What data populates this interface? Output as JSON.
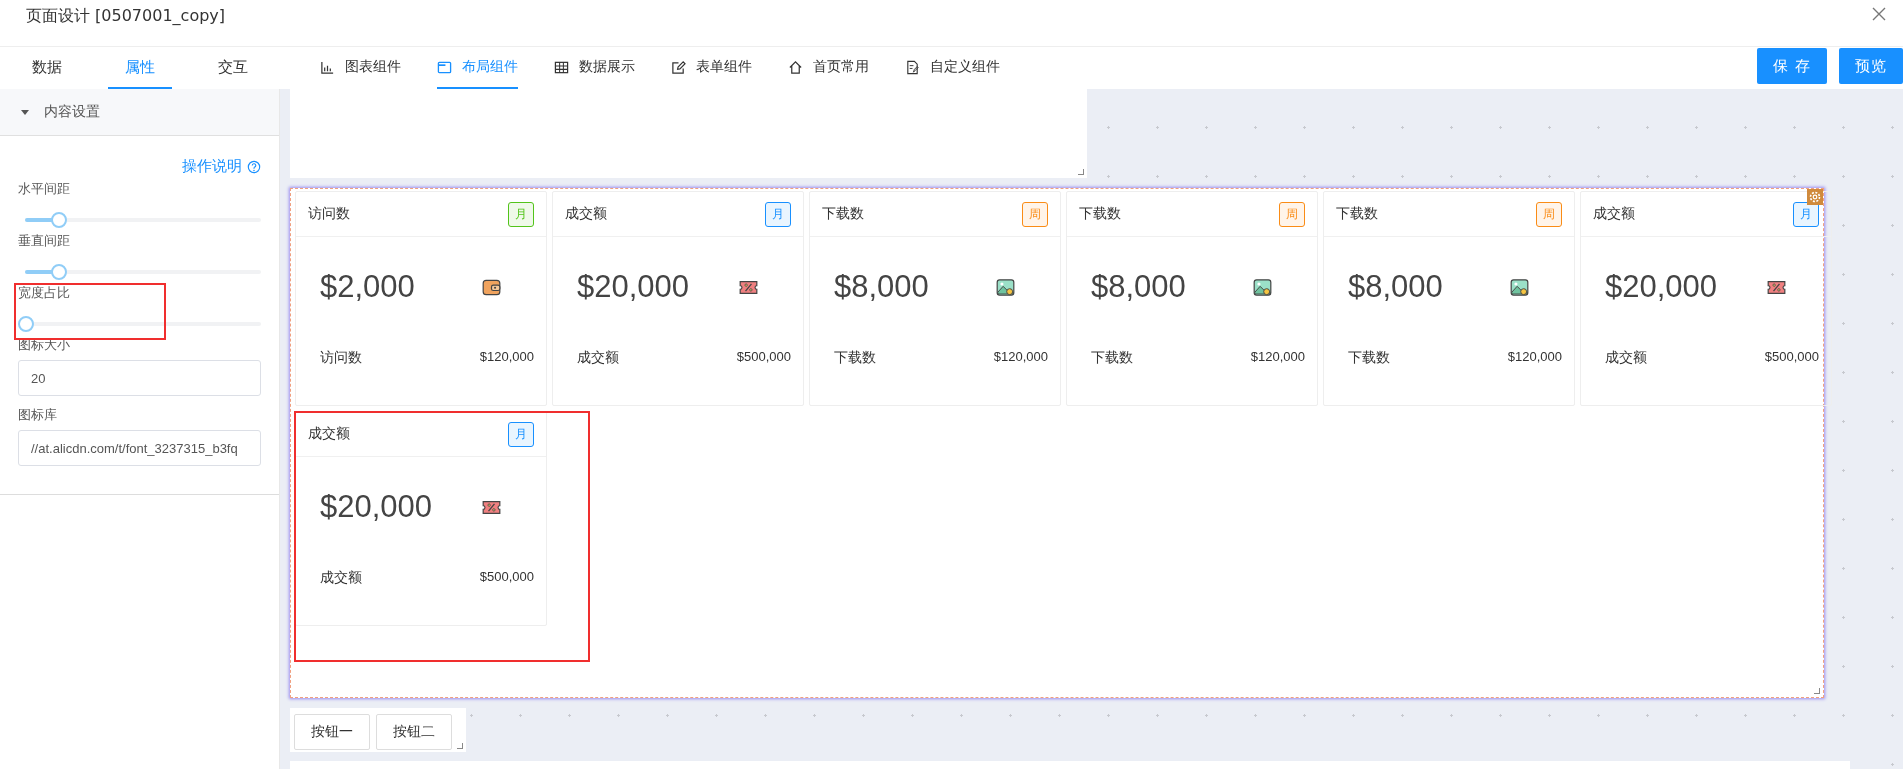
{
  "window": {
    "title": "页面设计 [0507001_copy]"
  },
  "panel_tabs": [
    {
      "label": "数据",
      "selected": false
    },
    {
      "label": "属性",
      "selected": true
    },
    {
      "label": "交互",
      "selected": false
    }
  ],
  "component_tabs": [
    {
      "label": "图表组件",
      "kind": "chart",
      "selected": false
    },
    {
      "label": "布局组件",
      "kind": "layout",
      "selected": true
    },
    {
      "label": "数据展示",
      "kind": "table",
      "selected": false
    },
    {
      "label": "表单组件",
      "kind": "form",
      "selected": false
    },
    {
      "label": "首页常用",
      "kind": "home",
      "selected": false
    },
    {
      "label": "自定义组件",
      "kind": "custom",
      "selected": false
    }
  ],
  "actions": [
    "保 存",
    "预览"
  ],
  "settings": {
    "section": "内容设置",
    "expanded": true,
    "help_link": "操作说明",
    "sliders": [
      {
        "label": "水平间距",
        "level": 0.14
      },
      {
        "label": "垂直间距",
        "level": 0.14
      },
      {
        "label": "宽度占比",
        "level": 0
      }
    ],
    "fields": [
      {
        "label": "图标大小",
        "value": "20"
      },
      {
        "label": "图标库",
        "value": "//at.alicdn.com/t/font_3237315_b3fq"
      }
    ]
  },
  "cards": [
    {
      "title": "访问数",
      "tag": "月",
      "color": "#52c41a",
      "value": "$2,000",
      "kind": "wallet",
      "footer_label": "访问数",
      "footer_value": "$120,000"
    },
    {
      "title": "成交额",
      "tag": "月",
      "color": "#1890ff",
      "value": "$20,000",
      "kind": "coupon",
      "footer_label": "成交额",
      "footer_value": "$500,000"
    },
    {
      "title": "下载数",
      "tag": "周",
      "color": "#fa8c16",
      "value": "$8,000",
      "kind": "image",
      "footer_label": "下载数",
      "footer_value": "$120,000"
    },
    {
      "title": "下载数",
      "tag": "周",
      "color": "#fa8c16",
      "value": "$8,000",
      "kind": "image",
      "footer_label": "下载数",
      "footer_value": "$120,000"
    },
    {
      "title": "下载数",
      "tag": "周",
      "color": "#fa8c16",
      "value": "$8,000",
      "kind": "image",
      "footer_label": "下载数",
      "footer_value": "$120,000"
    },
    {
      "title": "成交额",
      "tag": "月",
      "color": "#1890ff",
      "value": "$20,000",
      "kind": "coupon",
      "footer_label": "成交额",
      "footer_value": "$500,000"
    },
    {
      "title": "成交额",
      "tag": "月",
      "color": "#1890ff",
      "value": "$20,000",
      "kind": "coupon",
      "footer_label": "成交额",
      "footer_value": "$500,000"
    }
  ],
  "canvas_buttons": [
    "按钮一",
    "按钮二"
  ]
}
